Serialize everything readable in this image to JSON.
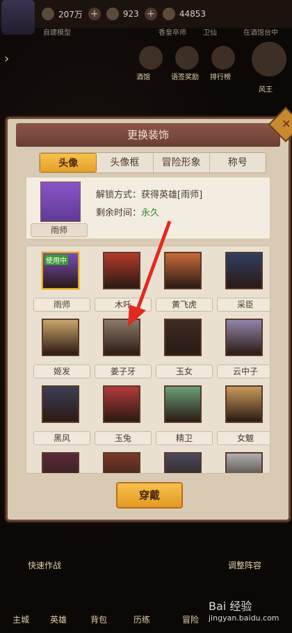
{
  "topbar": {
    "gold": "207万",
    "gems": "923",
    "stamina": "44853"
  },
  "sublabels": [
    "自建模型",
    "香皇卒师",
    "卫仙",
    "在酒馆台中"
  ],
  "side_labels": [
    "酒馆",
    "语签奖励",
    "排行榜",
    "风王"
  ],
  "modal": {
    "title": "更换装饰",
    "tabs": [
      "头像",
      "头像框",
      "冒险形象",
      "称号"
    ],
    "active_tab": 0,
    "info": {
      "portrait_name": "雨师",
      "unlock_label": "解锁方式：",
      "unlock_value": "获得英雄[雨师]",
      "time_label": "剩余时间：",
      "time_value": "永久"
    },
    "in_use_badge": "使用中",
    "heroes": [
      {
        "name": "雨师",
        "color": "#7a4bb8",
        "selected": true
      },
      {
        "name": "木吒",
        "color": "#b23a2a"
      },
      {
        "name": "黄飞虎",
        "color": "#c96b3a"
      },
      {
        "name": "采臣",
        "color": "#2f3f62"
      },
      {
        "name": "姬发",
        "color": "#c9a46a"
      },
      {
        "name": "姜子牙",
        "color": "#8a7a6a"
      },
      {
        "name": "玉女",
        "color": "#3c2c24"
      },
      {
        "name": "云中子",
        "color": "#8f86a8"
      },
      {
        "name": "黑风",
        "color": "#3e3e56"
      },
      {
        "name": "玉兔",
        "color": "#b23a3a"
      },
      {
        "name": "精卫",
        "color": "#6aa07a"
      },
      {
        "name": "女魃",
        "color": "#c89a5a"
      },
      {
        "name": "",
        "color": "#5a2a3a"
      },
      {
        "name": "",
        "color": "#7a3a2a"
      },
      {
        "name": "",
        "color": "#4a4a5a"
      },
      {
        "name": "",
        "color": "#b0b0b0"
      }
    ],
    "wear_button": "穿戴"
  },
  "bottom": {
    "labels": [
      "快速作战",
      "调整阵容",
      "主城",
      "英雄",
      "背包",
      "历练",
      "冒险"
    ]
  },
  "watermark": {
    "line1": "Bai 经验",
    "line2": "jingyan.baidu.com"
  },
  "colors": {
    "accent": "#f6c14e",
    "header": "#8a5648",
    "arrow": "#e02a1e"
  }
}
